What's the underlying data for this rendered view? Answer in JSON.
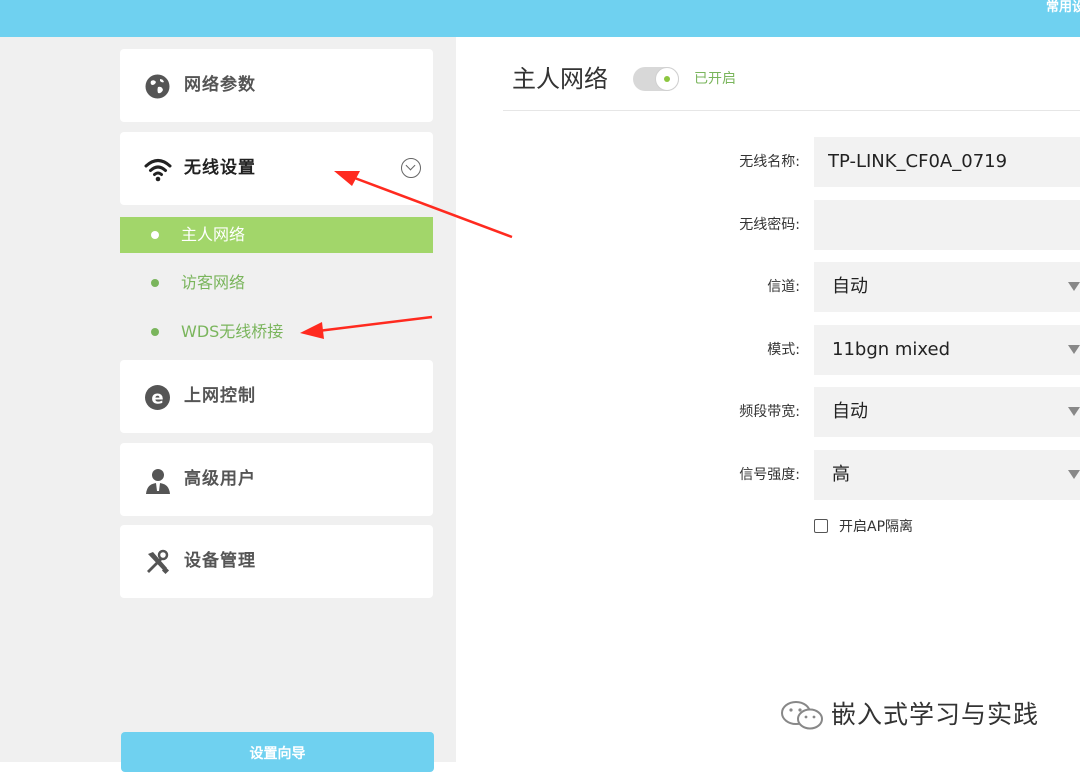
{
  "header": {
    "top_right_link": "常用设置"
  },
  "sidebar": {
    "menu": [
      {
        "label": "网络参数",
        "icon": "globe-icon"
      },
      {
        "label": "无线设置",
        "icon": "wifi-icon"
      },
      {
        "label": "上网控制",
        "icon": "internet-e-icon"
      },
      {
        "label": "高级用户",
        "icon": "user-icon"
      },
      {
        "label": "设备管理",
        "icon": "tools-icon"
      }
    ],
    "submenu": [
      {
        "label": "主人网络",
        "active": true
      },
      {
        "label": "访客网络",
        "active": false
      },
      {
        "label": "WDS无线桥接",
        "active": false
      }
    ],
    "wizard_button": "设置向导"
  },
  "main": {
    "title": "主人网络",
    "toggle_status": "已开启",
    "form": {
      "ssid_label": "无线名称:",
      "ssid_value": "TP-LINK_CF0A_0719",
      "password_label": "无线密码:",
      "password_value": "",
      "channel_label": "信道:",
      "channel_value": "自动",
      "mode_label": "模式:",
      "mode_value": "11bgn mixed",
      "bandwidth_label": "频段带宽:",
      "bandwidth_value": "自动",
      "signal_label": "信号强度:",
      "signal_value": "高",
      "ap_isolation_label": "开启AP隔离"
    }
  },
  "watermark": {
    "text": "嵌入式学习与实践"
  },
  "colors": {
    "accent_blue": "#6fd1f0",
    "accent_green": "#a2d66a",
    "text_green": "#7ab55c",
    "annotation_red": "#ff2a1f"
  }
}
